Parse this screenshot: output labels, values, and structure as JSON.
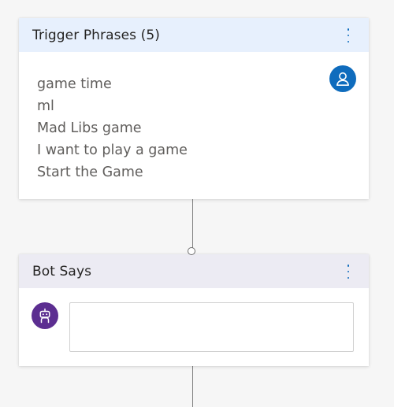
{
  "trigger_card": {
    "title": "Trigger Phrases (5)",
    "menu_icon": "more-vertical-icon",
    "avatar_icon": "person-icon",
    "phrases": [
      "game time",
      "ml",
      "Mad Libs game",
      "I want to play a game",
      "Start the Game"
    ]
  },
  "bot_card": {
    "title": "Bot Says",
    "menu_icon": "more-vertical-icon",
    "avatar_icon": "bot-icon",
    "message": {
      "value": "",
      "placeholder": ""
    }
  },
  "colors": {
    "canvas": "#f6f6f6",
    "trigger_header": "#e7f0fd",
    "bot_header": "#ecebf3",
    "accent": "#0f6cbd",
    "bot_avatar": "#5c2e91",
    "connector": "#7f7f7f"
  }
}
